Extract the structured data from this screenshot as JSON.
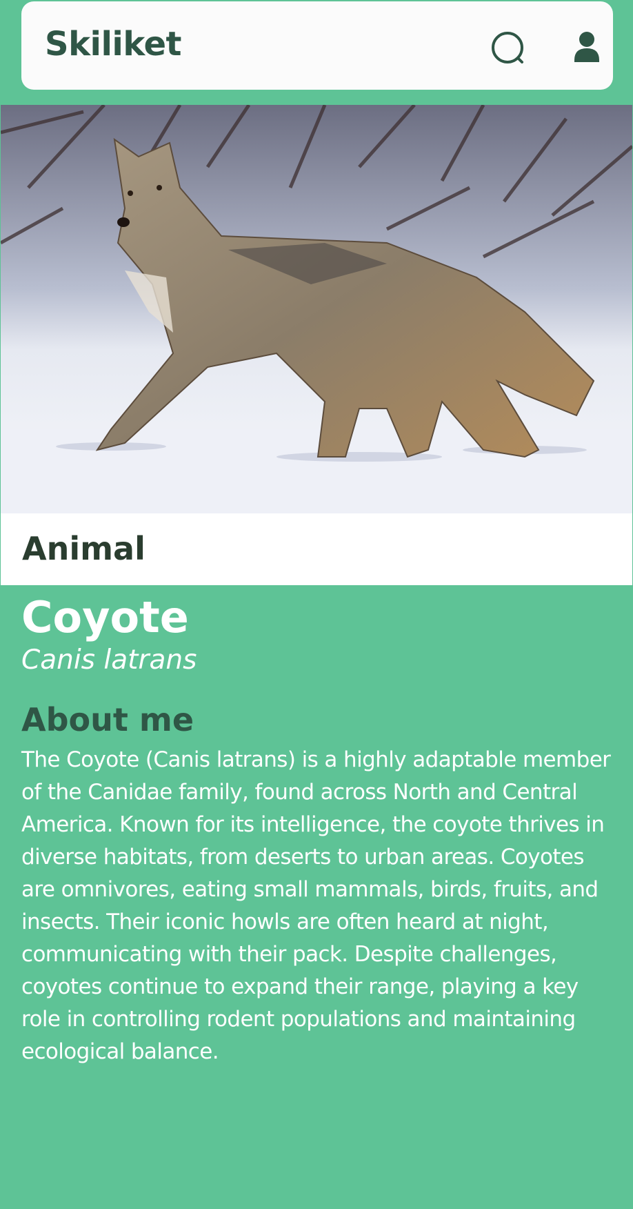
{
  "header": {
    "app_title": "Skiliket",
    "search_icon": "search-icon",
    "user_icon": "user-icon"
  },
  "hero": {
    "image_subject": "coyote walking on snow"
  },
  "species": {
    "category": "Animal",
    "name": "Coyote",
    "scientific_name": "Canis latrans"
  },
  "about": {
    "heading": "About me",
    "text": "The Coyote (Canis latrans) is a highly adaptable member of the Canidae family, found across North and Central America. Known for its intelligence, the coyote thrives in diverse habitats, from deserts to urban areas. Coyotes are omnivores, eating small mammals, birds, fruits, and insects. Their iconic howls are often heard at night, communicating with their pack. Despite challenges, coyotes continue to expand their range, playing a key role in controlling rodent populations and maintaining ecological balance."
  },
  "colors": {
    "background": "#5ec396",
    "header_bg": "#fbfbfb",
    "title_dark": "#2f5646",
    "category_text": "#2a3d2f",
    "body_text": "#ffffff"
  }
}
